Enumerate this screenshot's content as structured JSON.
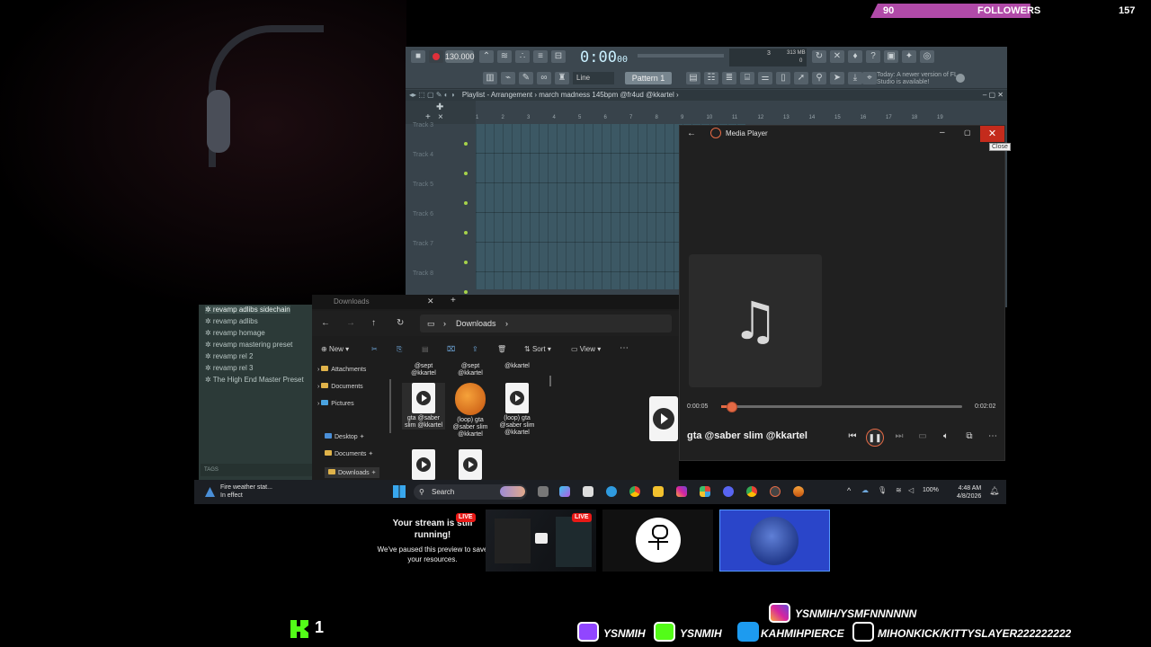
{
  "overlay": {
    "followers_current": "90",
    "followers_label": "FOLLOWERS",
    "followers_goal": "157",
    "followers_progress": 0.57,
    "kick_count": "1",
    "socials": {
      "instagram": "YSNMIH/YSMFNNNNNN",
      "twitch": "YSNMIH",
      "kick": "YSNMIH",
      "twitter": "KAHMIHPIERCE",
      "tiktok": "MIHONKICK/KITTYSLAYER222222222"
    },
    "accent_color": "#b04aa8"
  },
  "fl_studio": {
    "tempo": "130.000",
    "time": "0:00",
    "time_small": "00",
    "memory": "313 MB",
    "memory_b": "0",
    "step": "3",
    "line_label": "Line",
    "pattern": "Pattern 1",
    "news": "Today: A newer version of FL Studio is available!",
    "playlist_title": "Playlist - Arrangement › march madness 145bpm @fr4ud @kkartel ›",
    "tracks": [
      "Track 3",
      "Track 4",
      "Track 5",
      "Track 6",
      "Track 7",
      "Track 8"
    ],
    "ruler": [
      "1",
      "2",
      "3",
      "4",
      "5",
      "6",
      "7",
      "8",
      "9",
      "10",
      "11",
      "12",
      "13",
      "14",
      "15",
      "16",
      "17",
      "18",
      "19"
    ]
  },
  "mixer_list": {
    "items": [
      "revamp adlibs sidechain",
      "revamp adlibs",
      "revamp homage",
      "revamp mastering preset",
      "revamp rel 2",
      "revamp rel 3",
      "The High End Master Preset"
    ],
    "tags": "TAGS"
  },
  "media_player": {
    "title": "Media Player",
    "close_tooltip": "Close",
    "elapsed": "0:00:05",
    "duration": "0:02:02",
    "progress": 0.04,
    "song": "gta @saber slim @kkartel"
  },
  "explorer": {
    "tab_title": "Downloads",
    "address": "Downloads",
    "cmd_new": "New",
    "cmd_sort": "Sort",
    "cmd_view": "View",
    "sidebar": [
      "Attachments",
      "Documents",
      "Pictures",
      "Desktop",
      "Documents",
      "Downloads"
    ],
    "top_labels": [
      "@sept @kkartel",
      "@sept @kkartel",
      "@kkartel"
    ],
    "files": [
      "gta @saber slim @kkartel",
      "(loop) gta @saber slim @kkartel",
      "(loop) gta @saber slim @kkartel"
    ]
  },
  "taskbar": {
    "weather_line1": "Fire weather stat...",
    "weather_line2": "In effect",
    "search": "Search",
    "battery": "100%",
    "time": "4:48 AM",
    "date": "4/8/2026"
  },
  "preview": {
    "paused_title": "Your stream is still running!",
    "paused_sub": "We've paused this preview to save your resources.",
    "live": "LIVE"
  }
}
